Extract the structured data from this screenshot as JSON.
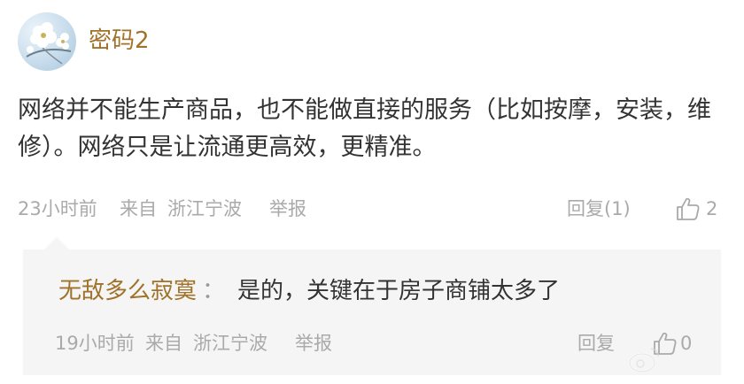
{
  "comment": {
    "username": "密码2",
    "content": "网络并不能生产商品，也不能做直接的服务（比如按摩，安装，维修）。网络只是让流通更高效，更精准。",
    "time": "23小时前",
    "from_label": "来自",
    "location": "浙江宁波",
    "report_label": "举报",
    "reply_label": "回复(1)",
    "like_count": "2",
    "avatar_icon": "flower-avatar",
    "like_icon": "thumbs-up-icon"
  },
  "reply": {
    "username": "无敌多么寂寞",
    "colon": "：",
    "content": "是的，关键在于房子商铺太多了",
    "time": "19小时前",
    "from_label": "来自",
    "location": "浙江宁波",
    "report_label": "举报",
    "reply_label": "回复",
    "like_count": "0",
    "like_icon": "thumbs-up-icon"
  },
  "colors": {
    "username": "#a0722a",
    "meta": "#aaaaaa",
    "reply_bg": "#f5f5f5",
    "text": "#333333"
  },
  "watermark": {
    "icon": "weibo-logo-icon"
  }
}
